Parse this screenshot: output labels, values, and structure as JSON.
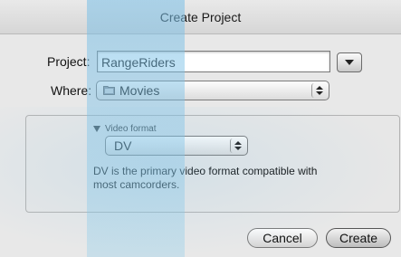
{
  "window": {
    "title": "Create Project"
  },
  "form": {
    "project_label": "Project:",
    "project_value": "RangeRiders",
    "where_label": "Where:",
    "where_value": "Movies"
  },
  "video_format": {
    "disclosure_label": "Video format",
    "selected": "DV",
    "description": "DV is the primary video format compatible with most camcorders."
  },
  "buttons": {
    "cancel": "Cancel",
    "create": "Create"
  },
  "icons": {
    "menu": "triangle-down-icon",
    "folder": "folder-icon",
    "popup_arrows": "up-down-arrows-icon",
    "disclosure": "disclosure-triangle-icon"
  },
  "colors": {
    "overlay_blue": "#7fc3e6"
  }
}
